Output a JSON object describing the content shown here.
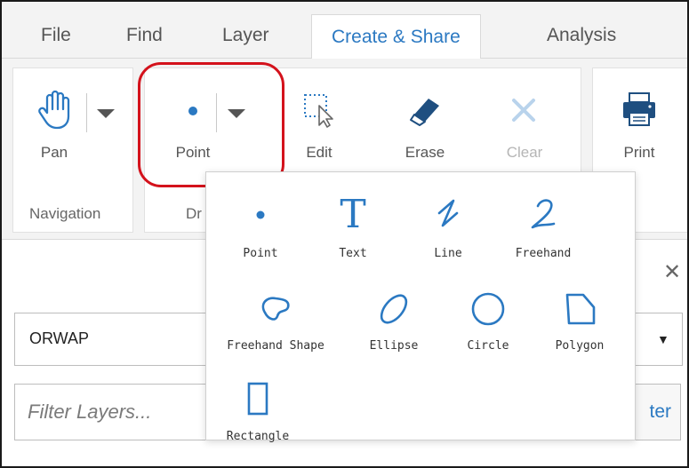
{
  "tabs": [
    {
      "label": "File"
    },
    {
      "label": "Find"
    },
    {
      "label": "Layer"
    },
    {
      "label": "Create & Share"
    },
    {
      "label": "Analysis"
    }
  ],
  "ribbon": {
    "navigation": {
      "group_label": "Navigation",
      "pan_label": "Pan"
    },
    "draw": {
      "group_label": "Dr",
      "point_label": "Point",
      "edit_label": "Edit",
      "erase_label": "Erase",
      "clear_label": "Clear"
    },
    "print": {
      "print_label": "Print"
    }
  },
  "draw_menu": {
    "items": [
      {
        "label": "Point"
      },
      {
        "label": "Text"
      },
      {
        "label": "Line"
      },
      {
        "label": "Freehand"
      },
      {
        "label": "Freehand Shape"
      },
      {
        "label": "Ellipse"
      },
      {
        "label": "Circle"
      },
      {
        "label": "Polygon"
      },
      {
        "label": "Rectangle"
      }
    ]
  },
  "layer_select": {
    "value": "ORWAP"
  },
  "filter": {
    "placeholder": "Filter Layers...",
    "button_label": "ter"
  },
  "colors": {
    "accent": "#2b79c2",
    "highlight": "#d4121c"
  }
}
